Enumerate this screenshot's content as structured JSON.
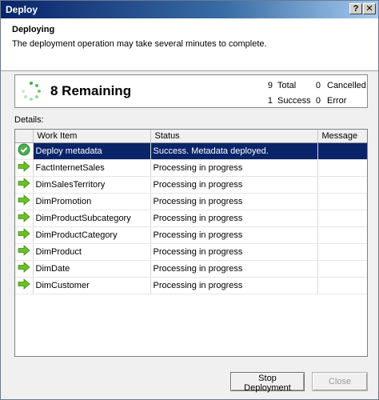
{
  "window": {
    "title": "Deploy",
    "help_label": "?",
    "close_label": "✕"
  },
  "header": {
    "title": "Deploying",
    "description": "The deployment operation may take several minutes to complete."
  },
  "status": {
    "remaining": "8 Remaining",
    "total_count": "9",
    "total_label": "Total",
    "cancelled_count": "0",
    "cancelled_label": "Cancelled",
    "success_count": "1",
    "success_label": "Success",
    "error_count": "0",
    "error_label": "Error"
  },
  "details": {
    "label": "Details:",
    "columns": [
      "Work Item",
      "Status",
      "Message"
    ],
    "rows": [
      {
        "icon": "success-icon",
        "item": "Deploy metadata",
        "status": "Success. Metadata deployed.",
        "message": ""
      },
      {
        "icon": "arrow-icon",
        "item": "FactInternetSales",
        "status": "Processing in progress",
        "message": ""
      },
      {
        "icon": "arrow-icon",
        "item": "DimSalesTerritory",
        "status": "Processing in progress",
        "message": ""
      },
      {
        "icon": "arrow-icon",
        "item": "DimPromotion",
        "status": "Processing in progress",
        "message": ""
      },
      {
        "icon": "arrow-icon",
        "item": "DimProductSubcategory",
        "status": "Processing in progress",
        "message": ""
      },
      {
        "icon": "arrow-icon",
        "item": "DimProductCategory",
        "status": "Processing in progress",
        "message": ""
      },
      {
        "icon": "arrow-icon",
        "item": "DimProduct",
        "status": "Processing in progress",
        "message": ""
      },
      {
        "icon": "arrow-icon",
        "item": "DimDate",
        "status": "Processing in progress",
        "message": ""
      },
      {
        "icon": "arrow-icon",
        "item": "DimCustomer",
        "status": "Processing in progress",
        "message": ""
      }
    ]
  },
  "buttons": {
    "stop": "Stop Deployment",
    "close": "Close"
  },
  "colors": {
    "selection": "#0a246a",
    "success": "#5cb85c",
    "arrow": "#6abf2a",
    "spinner": "#3cb043"
  }
}
